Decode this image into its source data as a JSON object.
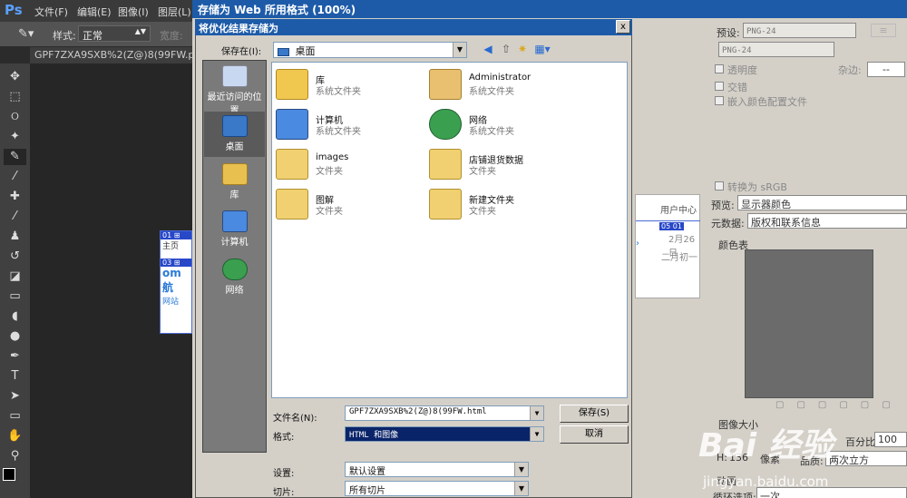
{
  "ps": {
    "logo": "Ps",
    "menus": [
      "文件(F)",
      "编辑(E)",
      "图像(I)",
      "图层(L)"
    ],
    "style_label": "样式:",
    "style_value": "正常",
    "width_label": "宽度:",
    "doc_tab": "GPF7ZXA9SXB%2(Z@)8(99FW.png @",
    "slice_tags": [
      "01",
      "03"
    ],
    "slice_texts": [
      "主页",
      "om",
      "航",
      "网站"
    ]
  },
  "sfw": {
    "title": "存储为 Web 所用格式 (100%)",
    "preset_label": "预设:",
    "preset_value": "PNG-24",
    "format_value": "PNG-24",
    "transparency": "透明度",
    "matte_label": "杂边:",
    "matte_value": "--",
    "interlaced": "交错",
    "embed_profile": "嵌入颜色配置文件",
    "convert_srgb": "转换为 sRGB",
    "preview_label": "预览:",
    "preview_value": "显示器颜色",
    "metadata_label": "元数据:",
    "metadata_value": "版权和联系信息",
    "color_table_label": "颜色表",
    "image_size_label": "图像大小",
    "percent_label": "百分比:",
    "percent_value": "100",
    "h_label": "H:",
    "h_value": "136",
    "pixel_label": "像素",
    "quality_label": "品质:",
    "quality_value": "两次立方",
    "animation_label": "动画",
    "loop_label": "循环选项:",
    "loop_value": "一次",
    "preview_header": "用户中心",
    "preview_date": "2月26日",
    "preview_date2": "二月初一",
    "preview_tags": [
      "05",
      "01"
    ]
  },
  "dialog": {
    "title": "将优化结果存储为",
    "close": "x",
    "save_in_label": "保存在(I):",
    "save_in_value": "桌面",
    "places": [
      {
        "label": "最近访问的位置"
      },
      {
        "label": "桌面"
      },
      {
        "label": "库"
      },
      {
        "label": "计算机"
      },
      {
        "label": "网络"
      }
    ],
    "files": [
      {
        "name": "库",
        "type": "系统文件夹",
        "icon": "library-icon"
      },
      {
        "name": "Administrator",
        "type": "系统文件夹",
        "icon": "user-folder-icon"
      },
      {
        "name": "计算机",
        "type": "系统文件夹",
        "icon": "computer-icon"
      },
      {
        "name": "网络",
        "type": "系统文件夹",
        "icon": "network-icon"
      },
      {
        "name": "images",
        "type": "文件夹",
        "icon": "folder-icon"
      },
      {
        "name": "店铺退货数据",
        "type": "文件夹",
        "icon": "folder-icon"
      },
      {
        "name": "图解",
        "type": "文件夹",
        "icon": "folder-icon"
      },
      {
        "name": "新建文件夹",
        "type": "文件夹",
        "icon": "folder-icon"
      }
    ],
    "filename_label": "文件名(N):",
    "filename_value": "GPF7ZXA9SXB%2(Z@)8(99FW.html",
    "format_label": "格式:",
    "format_value": "HTML 和图像",
    "save_button": "保存(S)",
    "cancel_button": "取消",
    "settings_label": "设置:",
    "settings_value": "默认设置",
    "slices_label": "切片:",
    "slices_value": "所有切片"
  },
  "watermark": {
    "text": "Bai 经验",
    "url": "jingyan.baidu.com"
  },
  "colors": {
    "titlebar": "#1d5ba8",
    "dialog_bg": "#d4d0c8",
    "ps_dark": "#3a3a3a"
  }
}
